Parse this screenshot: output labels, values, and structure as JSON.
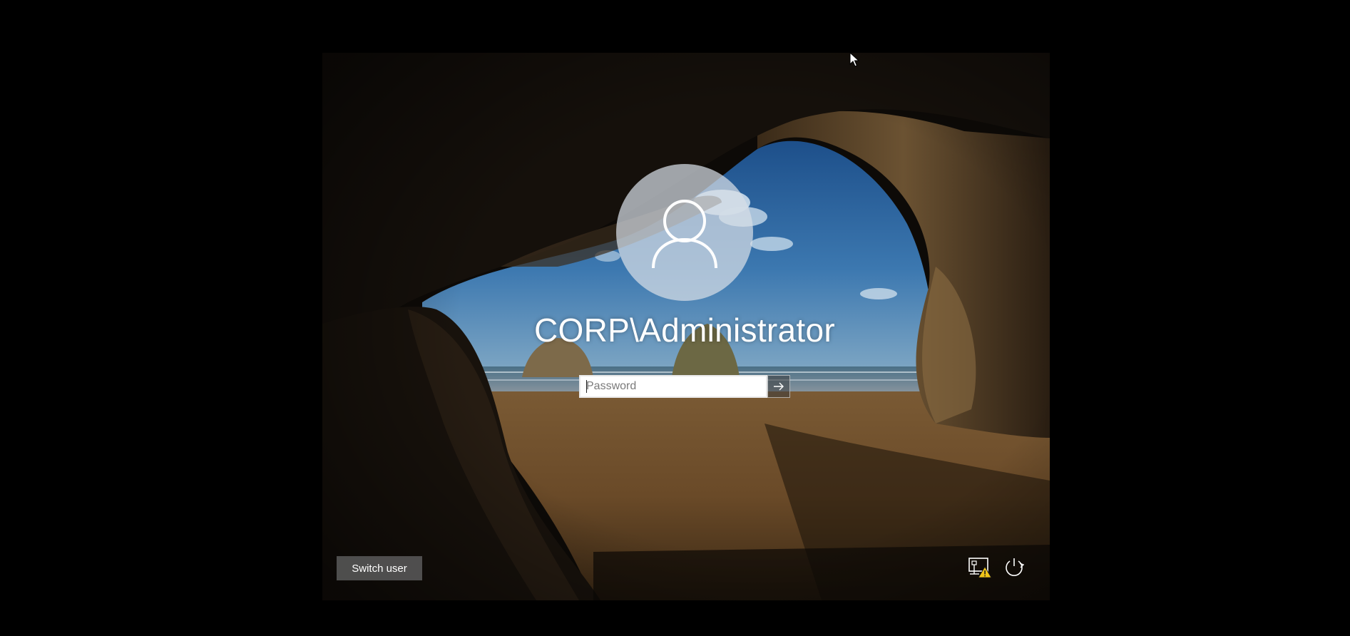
{
  "lock_screen": {
    "user": {
      "display_name": "CORP\\Administrator",
      "avatar_icon": "user-icon"
    },
    "password": {
      "placeholder": "Password",
      "value": "",
      "submit_icon": "arrow-right-icon"
    },
    "switch_user_label": "Switch user",
    "tray": {
      "network_icon": "network-warning-icon",
      "power_icon": "power-icon"
    }
  },
  "colors": {
    "screen_background": "#000000",
    "avatar_fill": "#d7dee6",
    "input_background": "#ffffff",
    "switch_user_background": "#5a5a5a",
    "warning": "#f0c419"
  }
}
